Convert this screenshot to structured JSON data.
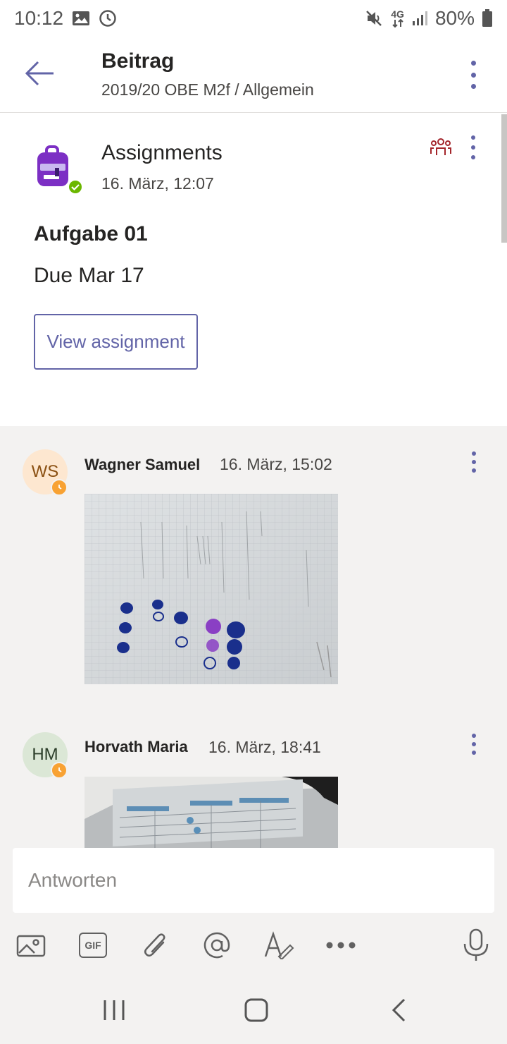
{
  "status_bar": {
    "time": "10:12",
    "network": "4G",
    "battery": "80%"
  },
  "header": {
    "title": "Beitrag",
    "subtitle": "2019/20 OBE M2f / Allgemein"
  },
  "post": {
    "app_name": "Assignments",
    "time": "16. März, 12:07",
    "assignment_title": "Aufgabe 01",
    "due": "Due Mar 17",
    "view_button": "View assignment"
  },
  "replies": [
    {
      "initials": "WS",
      "name": "Wagner Samuel",
      "time": "16. März, 15:02"
    },
    {
      "initials": "HM",
      "name": "Horvath Maria",
      "time": "16. März, 18:41"
    }
  ],
  "compose": {
    "placeholder": "Antworten"
  },
  "toolbar": {
    "gif_label": "GIF"
  },
  "colors": {
    "accent": "#6264a7",
    "app_purple": "#7c2fc4",
    "online": "#6bb700",
    "away": "#f8a233",
    "team_icon": "#a4262c",
    "background": "#f3f2f1"
  }
}
